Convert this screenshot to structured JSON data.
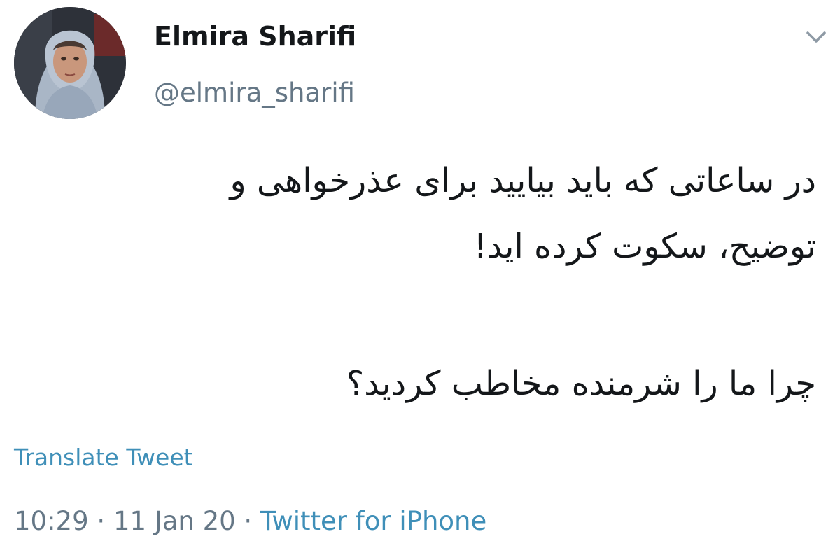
{
  "author": {
    "display_name": "Elmira Sharifi",
    "handle": "@elmira_sharifi"
  },
  "icons": {
    "avatar": "profile-photo",
    "menu": "chevron-down-icon"
  },
  "tweet": {
    "lines": [
      "در ساعاتی که باید بیایید برای عذرخواهی و",
      "توضیح، سکوت کرده اید!",
      "چرا ما را شرمنده مخاطب کردید؟"
    ],
    "translate_label": "Translate Tweet",
    "time": "10:29",
    "separator": " · ",
    "date": "11 Jan 20",
    "source": "Twitter for iPhone"
  },
  "colors": {
    "link": "#3f8fb8",
    "muted": "#657786",
    "text": "#14171a"
  }
}
